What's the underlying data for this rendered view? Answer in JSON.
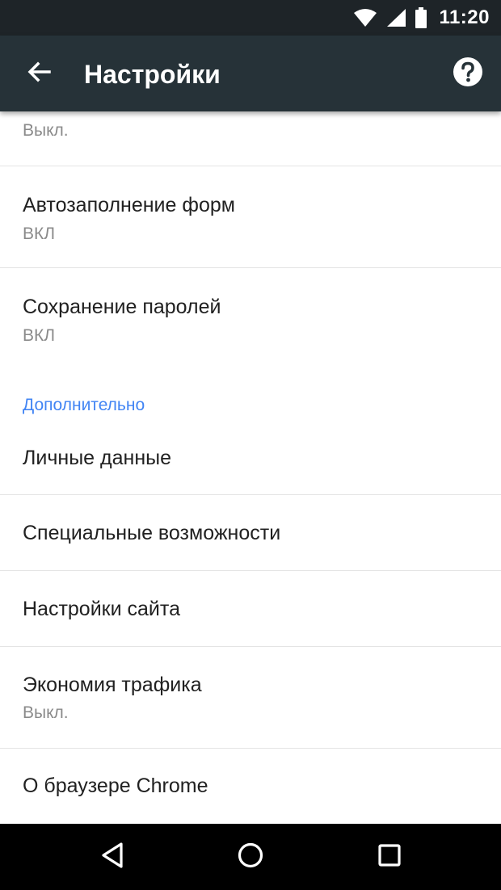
{
  "status_bar": {
    "time": "11:20",
    "icons": [
      "wifi-icon",
      "signal-icon",
      "battery-icon"
    ]
  },
  "toolbar": {
    "title": "Настройки",
    "back_icon": "arrow-back-icon",
    "help_icon": "help-icon"
  },
  "settings": {
    "partial_item": {
      "value": "Выкл."
    },
    "autofill": {
      "label": "Автозаполнение форм",
      "value": "ВКЛ"
    },
    "passwords": {
      "label": "Сохранение паролей",
      "value": "ВКЛ"
    },
    "advanced_header": "Дополнительно",
    "personal_data": {
      "label": "Личные данные"
    },
    "accessibility": {
      "label": "Специальные возможности"
    },
    "site_settings": {
      "label": "Настройки сайта"
    },
    "data_saver": {
      "label": "Экономия трафика",
      "value": "Выкл."
    },
    "about": {
      "label": "О браузере Chrome"
    }
  },
  "nav_bar": {
    "icons": [
      "nav-back-icon",
      "nav-home-icon",
      "nav-recents-icon"
    ]
  },
  "colors": {
    "toolbar": "#263238",
    "status_bar": "#1e2428",
    "accent": "#4285f4",
    "text_primary": "#212121",
    "text_secondary": "#8a8a8a"
  }
}
